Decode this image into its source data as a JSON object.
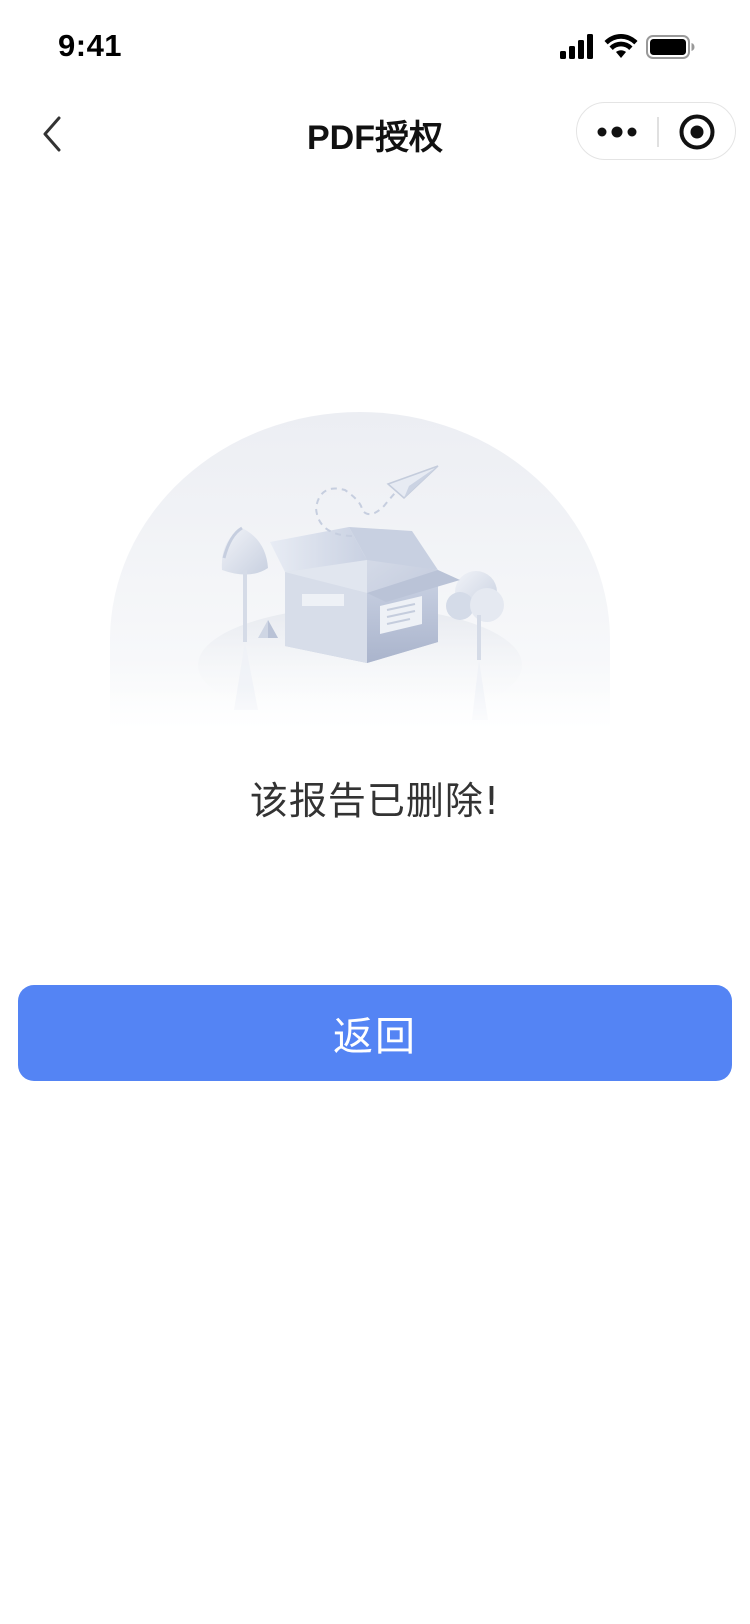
{
  "status_bar": {
    "time": "9:41",
    "icons": [
      "signal-icon",
      "wifi-icon",
      "battery-icon"
    ]
  },
  "nav": {
    "back_icon": "chevron-left-icon",
    "title": "PDF授权",
    "capsule": {
      "more_icon": "more-dots-icon",
      "close_icon": "target-close-icon"
    }
  },
  "empty_state": {
    "illustration": "empty-box-illustration",
    "message": "该报告已删除!"
  },
  "actions": {
    "back_label": "返回"
  },
  "colors": {
    "primary": "#5484f4",
    "text_primary": "#111111",
    "text_secondary": "#333333",
    "illustration_tint": "#c8d0e0"
  }
}
